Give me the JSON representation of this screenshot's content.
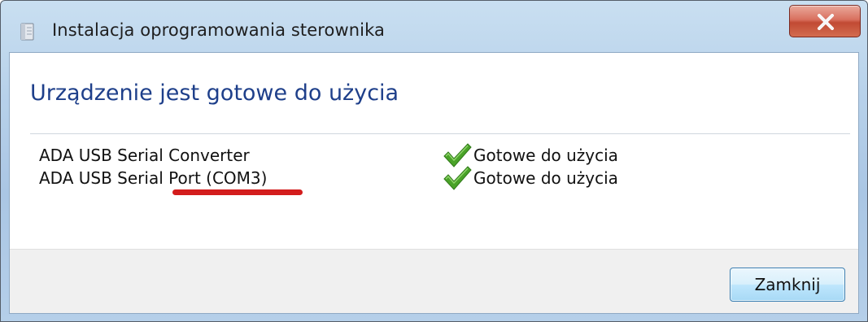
{
  "window": {
    "title": "Instalacja oprogramowania sterownika",
    "close_icon": "close-x-icon",
    "title_icon": "driver-installer-icon"
  },
  "content": {
    "heading": "Urządzenie jest gotowe do użycia",
    "devices": [
      {
        "name": "ADA USB Serial Converter",
        "status": "Gotowe do użycia",
        "status_icon": "green-checkmark-icon"
      },
      {
        "name": "ADA USB Serial Port (COM3)",
        "status": "Gotowe do użycia",
        "status_icon": "green-checkmark-icon"
      }
    ]
  },
  "footer": {
    "close_button_label": "Zamknij"
  },
  "colors": {
    "heading": "#1e3f8a",
    "check": "#4aa329",
    "annotation": "#d31d1d",
    "close_red": "#c14a33"
  }
}
